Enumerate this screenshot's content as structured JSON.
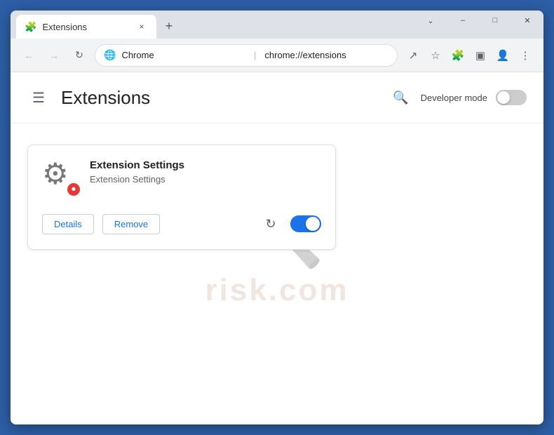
{
  "window": {
    "title": "Extensions",
    "controls": {
      "minimize": "–",
      "maximize": "□",
      "close": "✕",
      "chevron": "⌄"
    }
  },
  "tab": {
    "label": "Extensions",
    "close": "×",
    "new_tab": "+"
  },
  "omnibar": {
    "back": "←",
    "forward": "→",
    "reload": "↻",
    "chrome_label": "Chrome",
    "url": "chrome://extensions",
    "share_icon": "↗",
    "bookmark_icon": "☆",
    "extensions_icon": "🧩",
    "sidebar_icon": "▣",
    "profile_icon": "👤",
    "menu_icon": "⋮"
  },
  "page": {
    "hamburger": "☰",
    "title": "Extensions",
    "search_label": "🔍",
    "developer_mode_label": "Developer mode"
  },
  "extension_card": {
    "title": "Extension Settings",
    "description": "Extension Settings",
    "details_btn": "Details",
    "remove_btn": "Remove"
  },
  "watermark": {
    "text": "risk.com"
  }
}
